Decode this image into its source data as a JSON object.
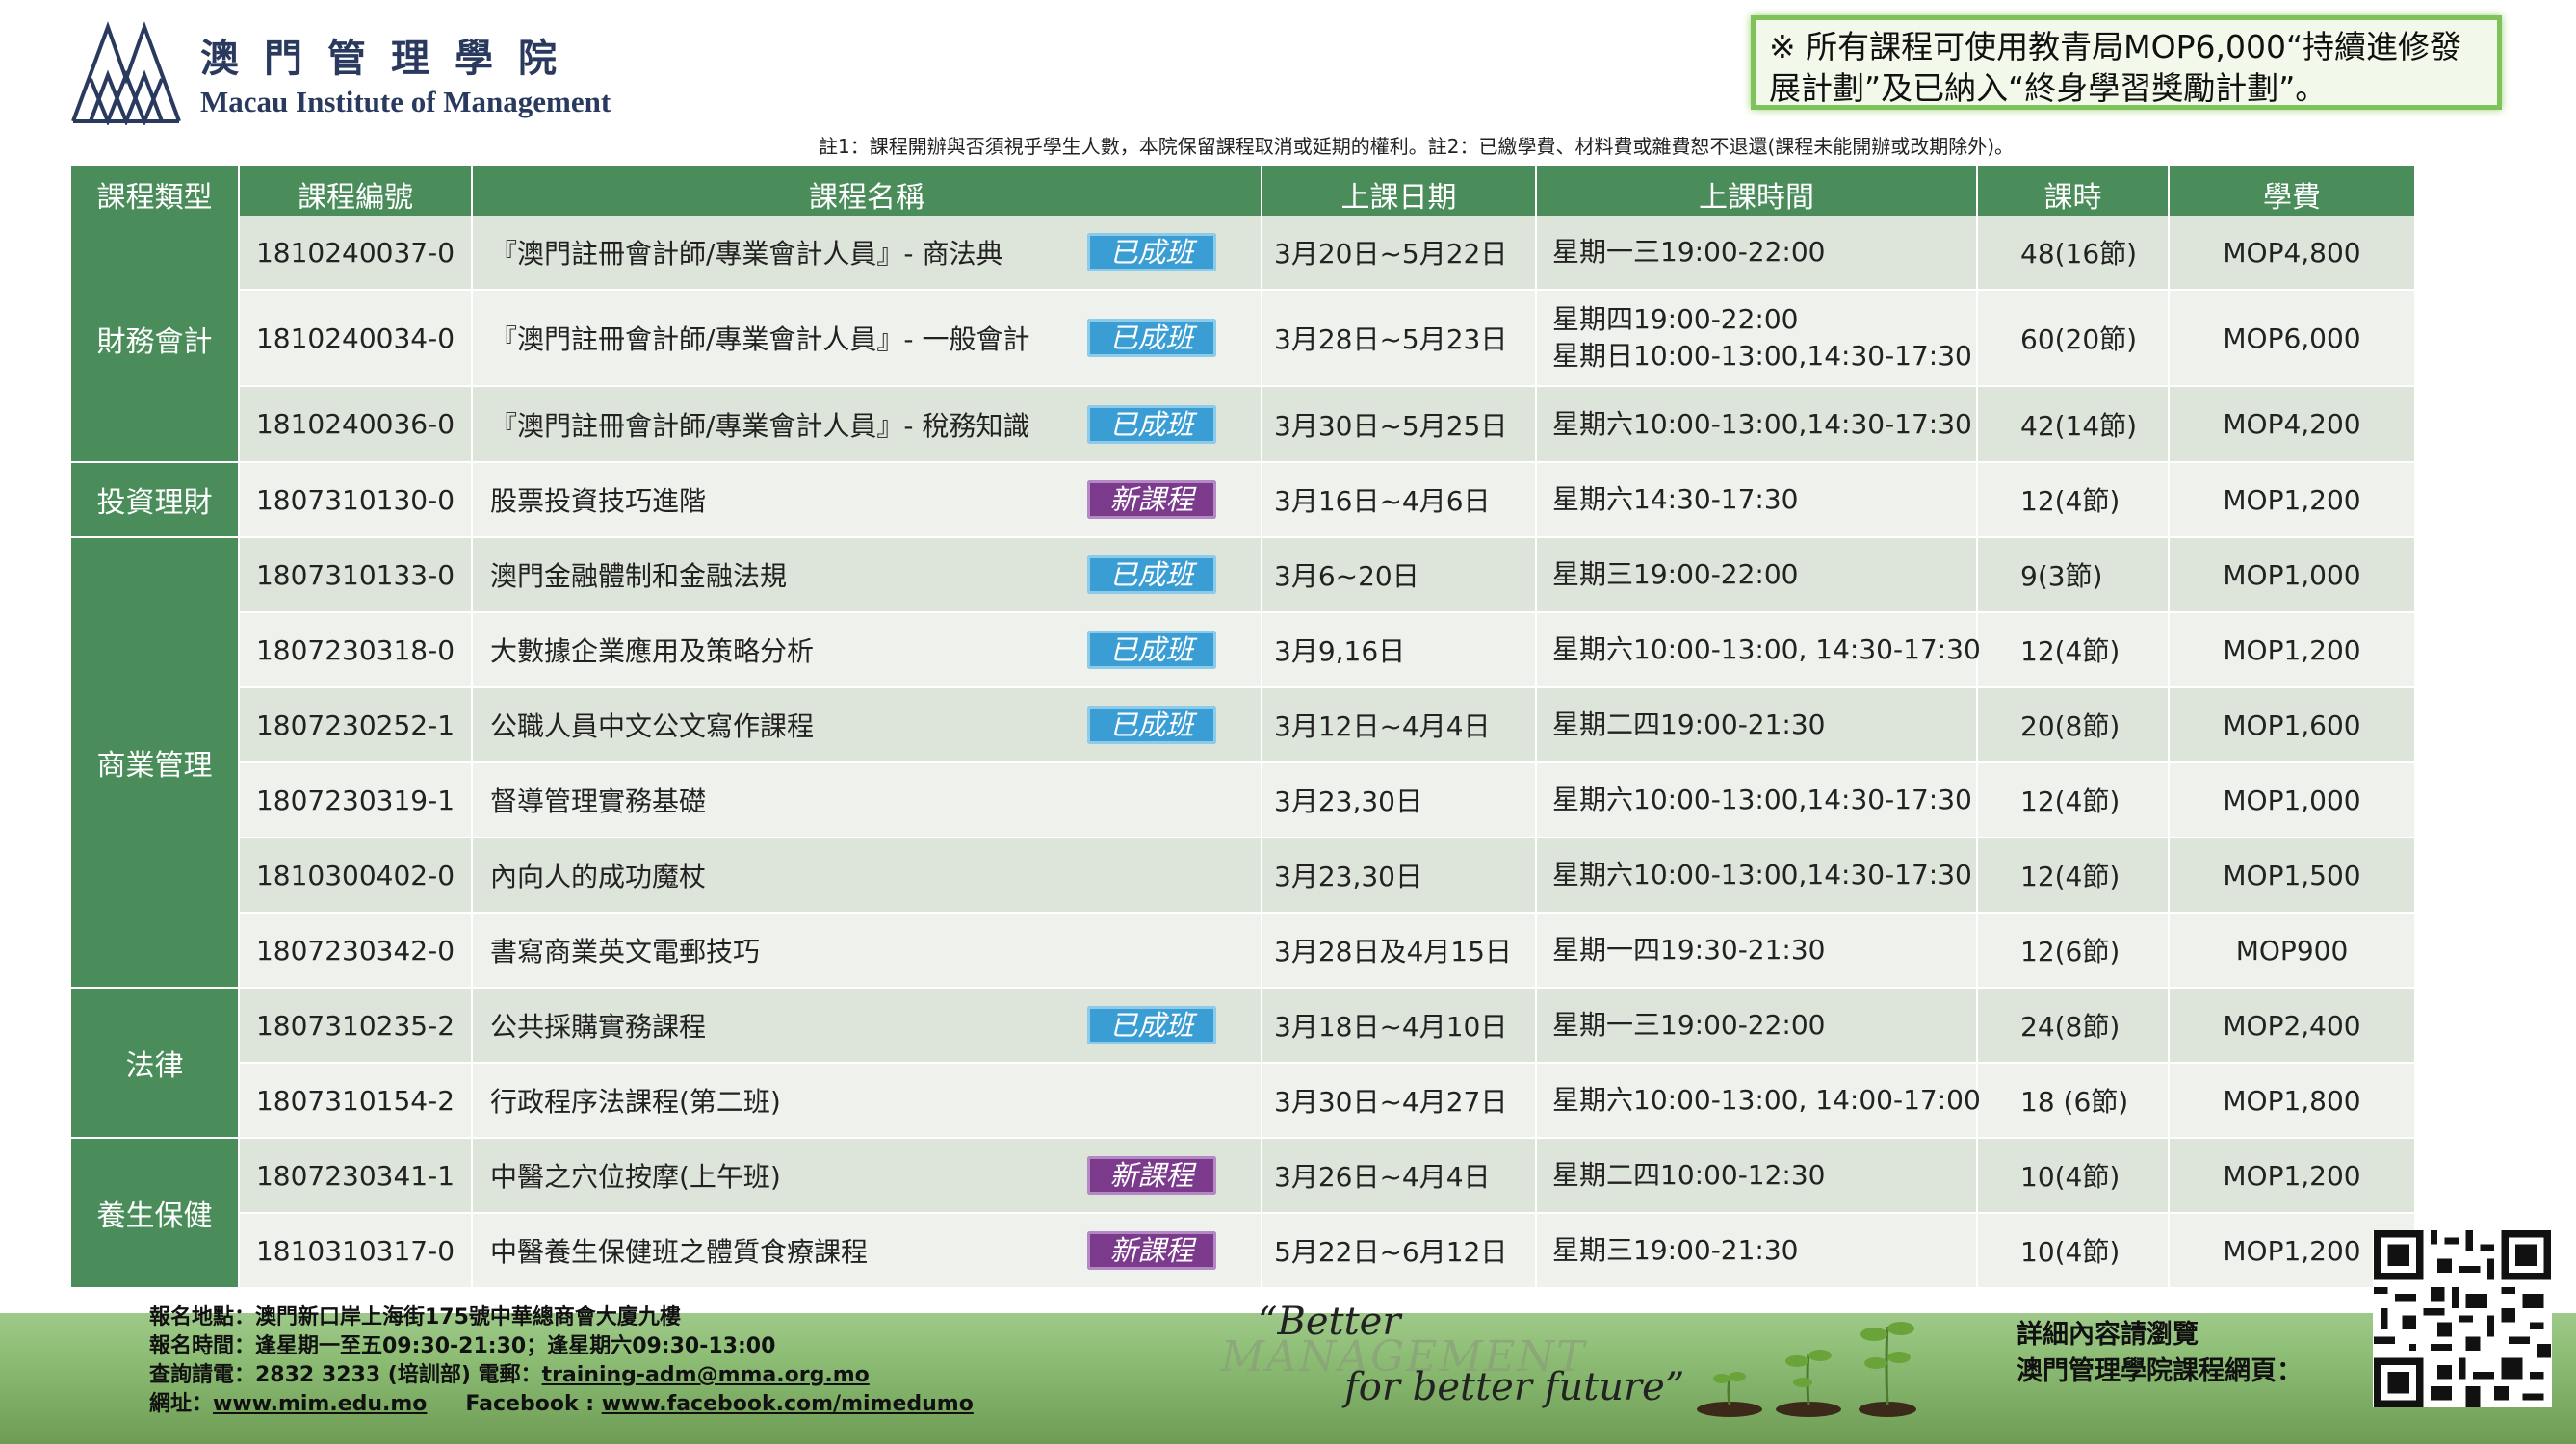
{
  "header": {
    "brand_zh": "澳門管理學院",
    "brand_en": "Macau Institute of Management",
    "notice": "※ 所有課程可使用教青局MOP6,000“持續進修發展計劃”及已納入“終身學習獎勵計劃”。",
    "note": "註1：課程開辦與否須視乎學生人數，本院保留課程取消或延期的權利。註2：已繳學費、材料費或雜費恕不退還(課程未能開辦或改期除外)。"
  },
  "table": {
    "headers": [
      "課程類型",
      "課程編號",
      "課程名稱",
      "上課日期",
      "上課時間",
      "課時",
      "學費"
    ],
    "categories": [
      "財務會計",
      "投資理財",
      "商業管理",
      "法律",
      "養生保健"
    ],
    "badges": {
      "formed": "已成班",
      "new": "新課程"
    },
    "rows": [
      {
        "code": "1810240037-0",
        "name": "『澳門註冊會計師/專業會計人員』- 商法典",
        "date": "3月20日~5月22日",
        "time": "星期一三19:00-22:00",
        "time2": "",
        "hours": "48(16節)",
        "fee": "MOP4,800"
      },
      {
        "code": "1810240034-0",
        "name": "『澳門註冊會計師/專業會計人員』- 一般會計",
        "date": "3月28日~5月23日",
        "time": "星期四19:00-22:00",
        "time2": "星期日10:00-13:00,14:30-17:30",
        "hours": "60(20節)",
        "fee": "MOP6,000"
      },
      {
        "code": "1810240036-0",
        "name": "『澳門註冊會計師/專業會計人員』- 稅務知識",
        "date": "3月30日~5月25日",
        "time": "星期六10:00-13:00,14:30-17:30",
        "time2": "",
        "hours": "42(14節)",
        "fee": "MOP4,200"
      },
      {
        "code": "1807310130-0",
        "name": "股票投資技巧進階",
        "date": "3月16日~4月6日",
        "time": "星期六14:30-17:30",
        "time2": "",
        "hours": "12(4節)",
        "fee": "MOP1,200"
      },
      {
        "code": "1807310133-0",
        "name": "澳門金融體制和金融法規",
        "date": "3月6~20日",
        "time": "星期三19:00-22:00",
        "time2": "",
        "hours": "9(3節)",
        "fee": "MOP1,000"
      },
      {
        "code": "1807230318-0",
        "name": "大數據企業應用及策略分析",
        "date": "3月9,16日",
        "time": "星期六10:00-13:00, 14:30-17:30",
        "time2": "",
        "hours": "12(4節)",
        "fee": "MOP1,200"
      },
      {
        "code": "1807230252-1",
        "name": "公職人員中文公文寫作課程",
        "date": "3月12日~4月4日",
        "time": "星期二四19:00-21:30",
        "time2": "",
        "hours": "20(8節)",
        "fee": "MOP1,600"
      },
      {
        "code": "1807230319-1",
        "name": "督導管理實務基礎",
        "date": "3月23,30日",
        "time": "星期六10:00-13:00,14:30-17:30",
        "time2": "",
        "hours": "12(4節)",
        "fee": "MOP1,000"
      },
      {
        "code": "1810300402-0",
        "name": "內向人的成功魔杖",
        "date": "3月23,30日",
        "time": "星期六10:00-13:00,14:30-17:30",
        "time2": "",
        "hours": "12(4節)",
        "fee": "MOP1,500"
      },
      {
        "code": "1807230342-0",
        "name": "書寫商業英文電郵技巧",
        "date": "3月28日及4月15日",
        "time": "星期一四19:30-21:30",
        "time2": "",
        "hours": "12(6節)",
        "fee": "MOP900"
      },
      {
        "code": "1807310235-2",
        "name": "公共採購實務課程",
        "date": "3月18日~4月10日",
        "time": "星期一三19:00-22:00",
        "time2": "",
        "hours": "24(8節)",
        "fee": "MOP2,400"
      },
      {
        "code": "1807310154-2",
        "name": "行政程序法課程(第二班)",
        "date": "3月30日~4月27日",
        "time": "星期六10:00-13:00, 14:00-17:00",
        "time2": "",
        "hours": "18 (6節)",
        "fee": "MOP1,800"
      },
      {
        "code": "1807230341-1",
        "name": "中醫之穴位按摩(上午班)",
        "date": "3月26日~4月4日",
        "time": "星期二四10:00-12:30",
        "time2": "",
        "hours": "10(4節)",
        "fee": "MOP1,200"
      },
      {
        "code": "1810310317-0",
        "name": "中醫養生保健班之體質食療課程",
        "date": "5月22日~6月12日",
        "time": "星期三19:00-21:30",
        "time2": "",
        "hours": "10(4節)",
        "fee": "MOP1,200"
      }
    ]
  },
  "footer": {
    "address": "報名地點：澳門新口岸上海街175號中華總商會大廈九樓",
    "hours": "報名時間：逢星期一至五09:30-21:30；逢星期六09:30-13:00",
    "phone_label": "查詢請電：2832 3233 (培訓部)  電郵：",
    "email": "training-adm@mma.org.mo",
    "web_label": "網址：",
    "web": "www.mim.edu.mo",
    "fb_label": "Facebook : ",
    "fb": "www.facebook.com/mimedumo",
    "slogan_1": "“Better",
    "slogan_2": "MANAGEMENT",
    "slogan_3": "for better future”",
    "more_1": "詳細內容請瀏覽",
    "more_2": "澳門管理學院課程網頁："
  },
  "colors": {
    "header_green": "#4a8d5b",
    "badge_formed": "#3a9ed4",
    "badge_new": "#7b3a8c",
    "notice_border": "#7fc25a"
  }
}
